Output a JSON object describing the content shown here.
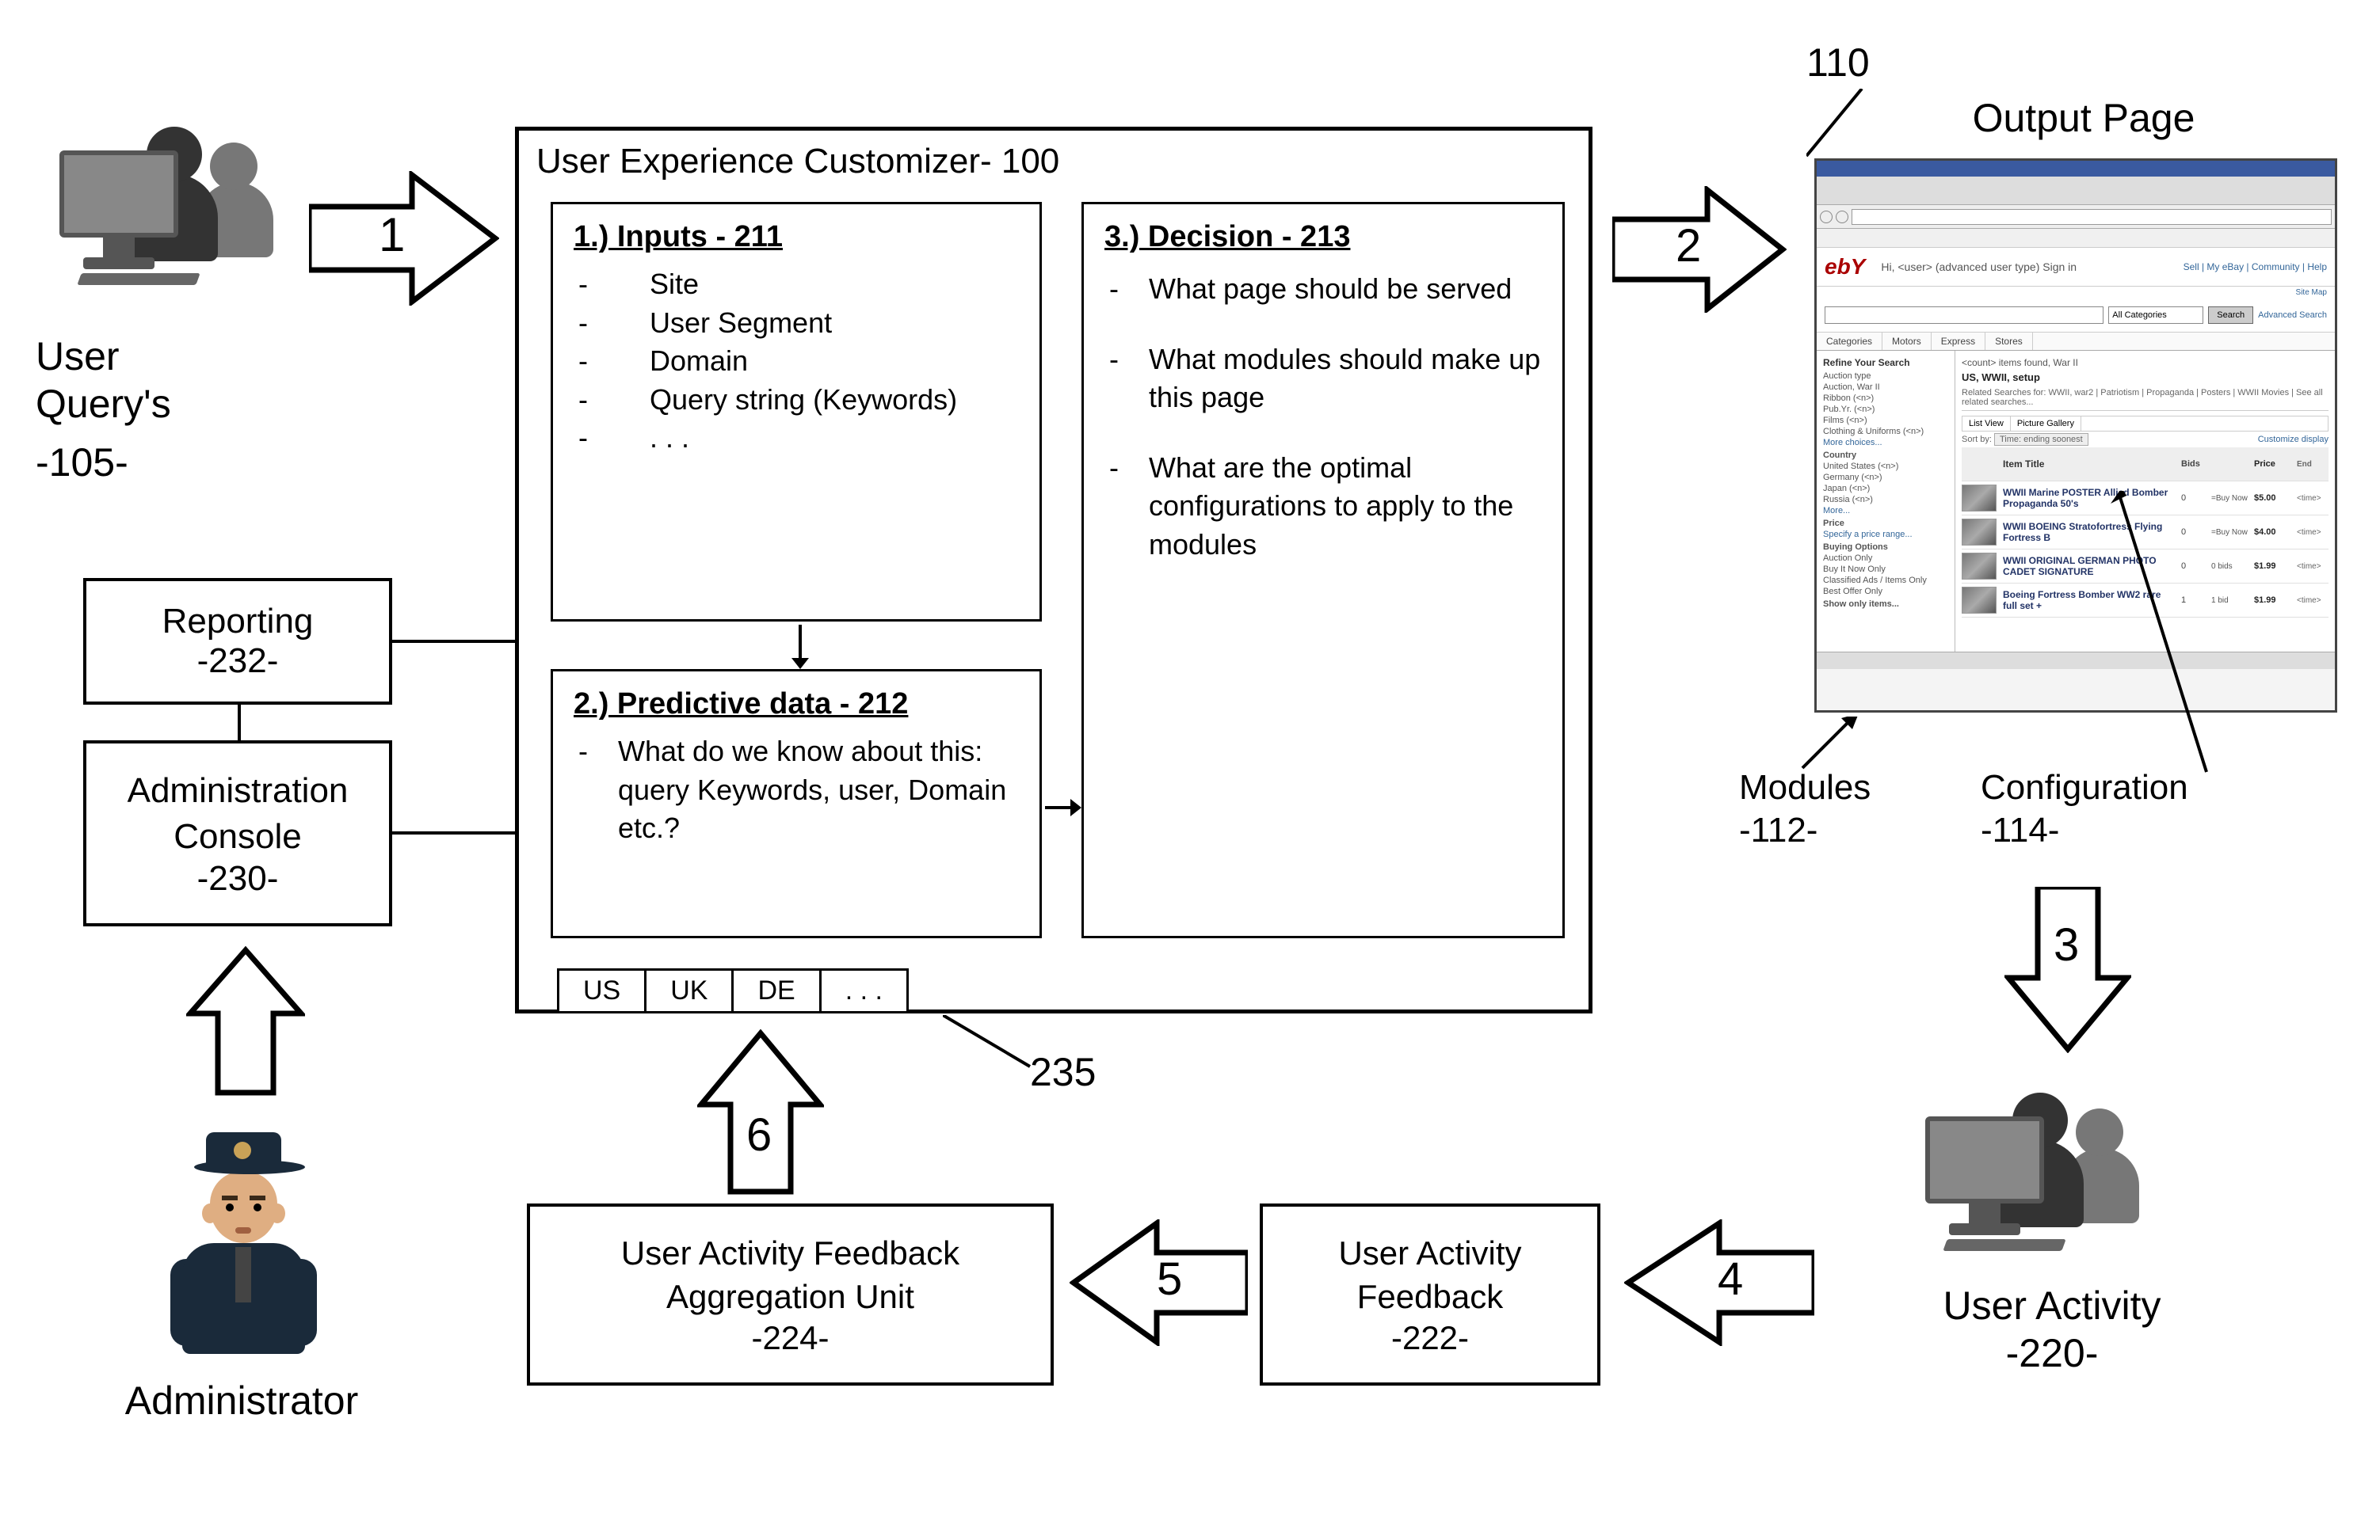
{
  "left": {
    "user_query_label": "User\nQuery's",
    "user_query_ref": "-105-",
    "reporting_label": "Reporting",
    "reporting_ref": "-232-",
    "admin_console_label": "Administration\nConsole",
    "admin_console_ref": "-230-",
    "administrator_label": "Administrator"
  },
  "arrows": {
    "a1": "1",
    "a2": "2",
    "a3": "3",
    "a4": "4",
    "a5": "5",
    "a6": "6"
  },
  "customizer": {
    "title": "User Experience Customizer- 100",
    "inputs": {
      "heading": "1.) Inputs - 211",
      "items": [
        "Site",
        "User Segment",
        "Domain",
        "Query string (Keywords)",
        ". . ."
      ]
    },
    "predictive": {
      "heading": "2.) Predictive data - 212",
      "items": [
        "What do we know about this: query Keywords, user, Domain etc.?"
      ]
    },
    "decision": {
      "heading": "3.) Decision - 213",
      "items": [
        "What page should be served",
        "What modules should make up this page",
        "What are the optimal configurations to apply to the modules"
      ]
    },
    "tabs": [
      "US",
      "UK",
      "DE",
      ". . ."
    ],
    "tabs_ref": "235"
  },
  "output": {
    "ref_top": "110",
    "title": "Output Page",
    "modules_label": "Modules",
    "modules_ref": "-112-",
    "config_label": "Configuration",
    "config_ref": "-114-",
    "mock": {
      "logo": "ebY",
      "welcome": "Hi, <user> (advanced user type) Sign in",
      "nav_right": "Sell | My eBay | Community | Help",
      "site_map": "Site Map",
      "search_cat": "All Categories",
      "search_btn": "Search",
      "search_adv": "Advanced Search",
      "tabs": [
        "Categories",
        "Motors",
        "Express",
        "Stores"
      ],
      "sidebar_title": "Refine Your Search",
      "sidebar_items": [
        "Auction type",
        "Auction, War II",
        "Ribbon  (<n>)",
        "Pub.Yr.  (<n>)",
        "Films  (<n>)",
        "Clothing & Uniforms  (<n>)",
        "More choices...",
        "Country",
        "United States  (<n>)",
        "Germany  (<n>)",
        "Japan  (<n>)",
        "Russia  (<n>)",
        "More...",
        "Price",
        "Specify a price range...",
        "Buying Options",
        "Auction Only",
        "Buy It Now Only",
        "Classified Ads / Items Only",
        "Best Offer Only",
        "Show only items..."
      ],
      "results_found": "<count> items found, War II",
      "results_query": "US, WWII, setup",
      "related": "Related Searches for: WWII, war2 | Patriotism | Propaganda | Posters | WWII Movies | See all related searches...",
      "view_opts": [
        "List View",
        "Picture Gallery"
      ],
      "sort_label": "Sort by:",
      "sort_value": "Time: ending soonest",
      "sort_custom": "Customize display",
      "col_headers": [
        "",
        "Item Title",
        "Bids",
        "",
        "Price",
        "End"
      ],
      "rows": [
        {
          "title": "WWII Marine POSTER Allied Bomber Propaganda 50's",
          "bids": "0",
          "fmt": "=Buy Now",
          "price": "$5.00",
          "end": "<time>"
        },
        {
          "title": "WWII BOEING Stratofortress Flying Fortress B",
          "bids": "0",
          "fmt": "=Buy Now",
          "price": "$4.00",
          "end": "<time>"
        },
        {
          "title": "WWII ORIGINAL GERMAN PHOTO CADET SIGNATURE",
          "bids": "0",
          "fmt": "0 bids",
          "price": "$1.99",
          "end": "<time>"
        },
        {
          "title": "Boeing Fortress Bomber WW2 rare full set +",
          "bids": "1",
          "fmt": "1 bid",
          "price": "$1.99",
          "end": "<time>"
        }
      ]
    }
  },
  "right_bottom": {
    "user_activity_label": "User Activity",
    "user_activity_ref": "-220-"
  },
  "bottom": {
    "feedback_label": "User Activity\nFeedback",
    "feedback_ref": "-222-",
    "aggregation_label": "User Activity Feedback\nAggregation Unit",
    "aggregation_ref": "-224-"
  }
}
